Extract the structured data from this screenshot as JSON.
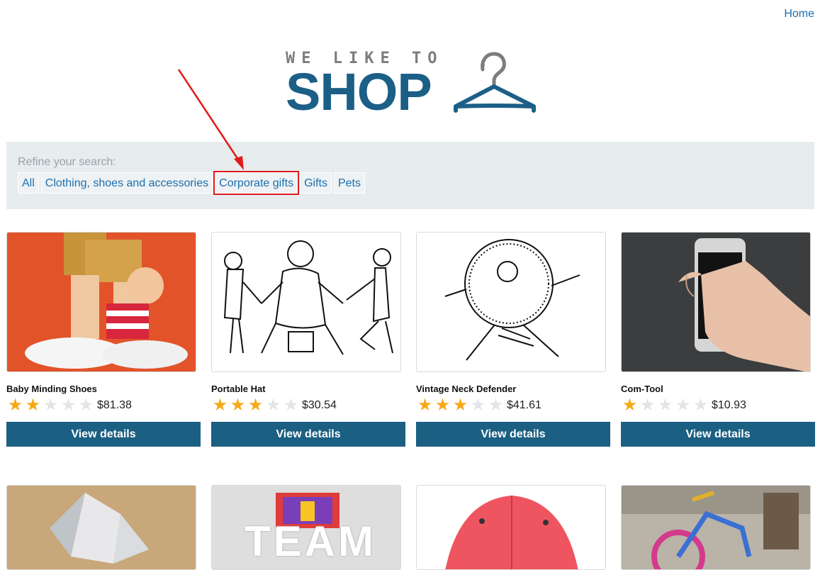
{
  "header": {
    "home_label": "Home",
    "logo_small": "WE LIKE TO",
    "logo_big": "SHOP"
  },
  "filter": {
    "title": "Refine your search:",
    "items": [
      {
        "label": "All"
      },
      {
        "label": "Clothing, shoes and accessories"
      },
      {
        "label": "Corporate gifts"
      },
      {
        "label": "Gifts"
      },
      {
        "label": "Pets"
      }
    ]
  },
  "products": [
    {
      "name": "Baby Minding Shoes",
      "rating": 2,
      "price": "$81.38",
      "button": "View details"
    },
    {
      "name": "Portable Hat",
      "rating": 3,
      "price": "$30.54",
      "button": "View details"
    },
    {
      "name": "Vintage Neck Defender",
      "rating": 3,
      "price": "$41.61",
      "button": "View details"
    },
    {
      "name": "Com-Tool",
      "rating": 1,
      "price": "$10.93",
      "button": "View details"
    }
  ],
  "row2_images": [
    {
      "text": ""
    },
    {
      "text": "TEAM"
    },
    {
      "text": ""
    },
    {
      "text": ""
    }
  ],
  "colors": {
    "accent": "#1b5f82",
    "link": "#1a6fb0",
    "star": "#f6a917",
    "highlight": "#e01b1b"
  }
}
